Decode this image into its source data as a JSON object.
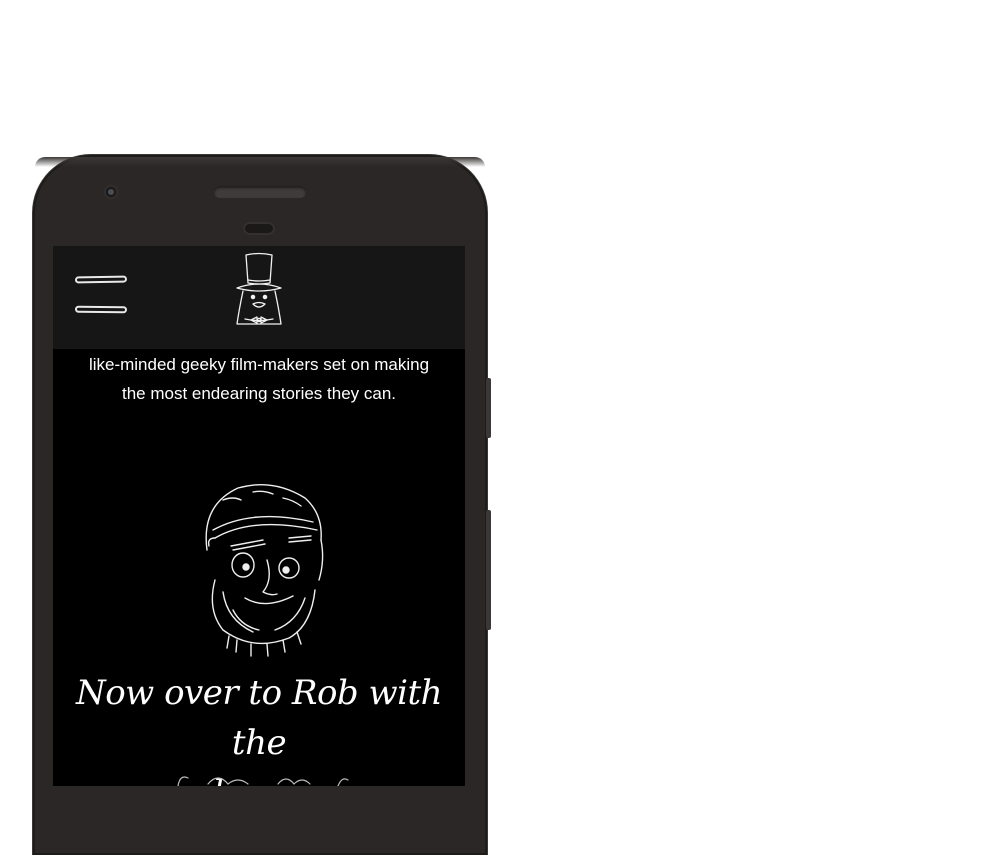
{
  "header": {
    "menu_icon": "hamburger-menu-icon",
    "logo_icon": "top-hat-character-logo"
  },
  "intro": {
    "line1": "like-minded geeky film-makers set on making",
    "line2": "the most endearing stories they can."
  },
  "portrait_icon": "bearded-man-beanie-sketch",
  "headline": {
    "line1": "Now over to Rob with the",
    "line2": "plan . . ."
  },
  "colors": {
    "screen_bg": "#000000",
    "header_bg": "#161616",
    "phone_body": "#2a2726",
    "text": "#ffffff"
  }
}
